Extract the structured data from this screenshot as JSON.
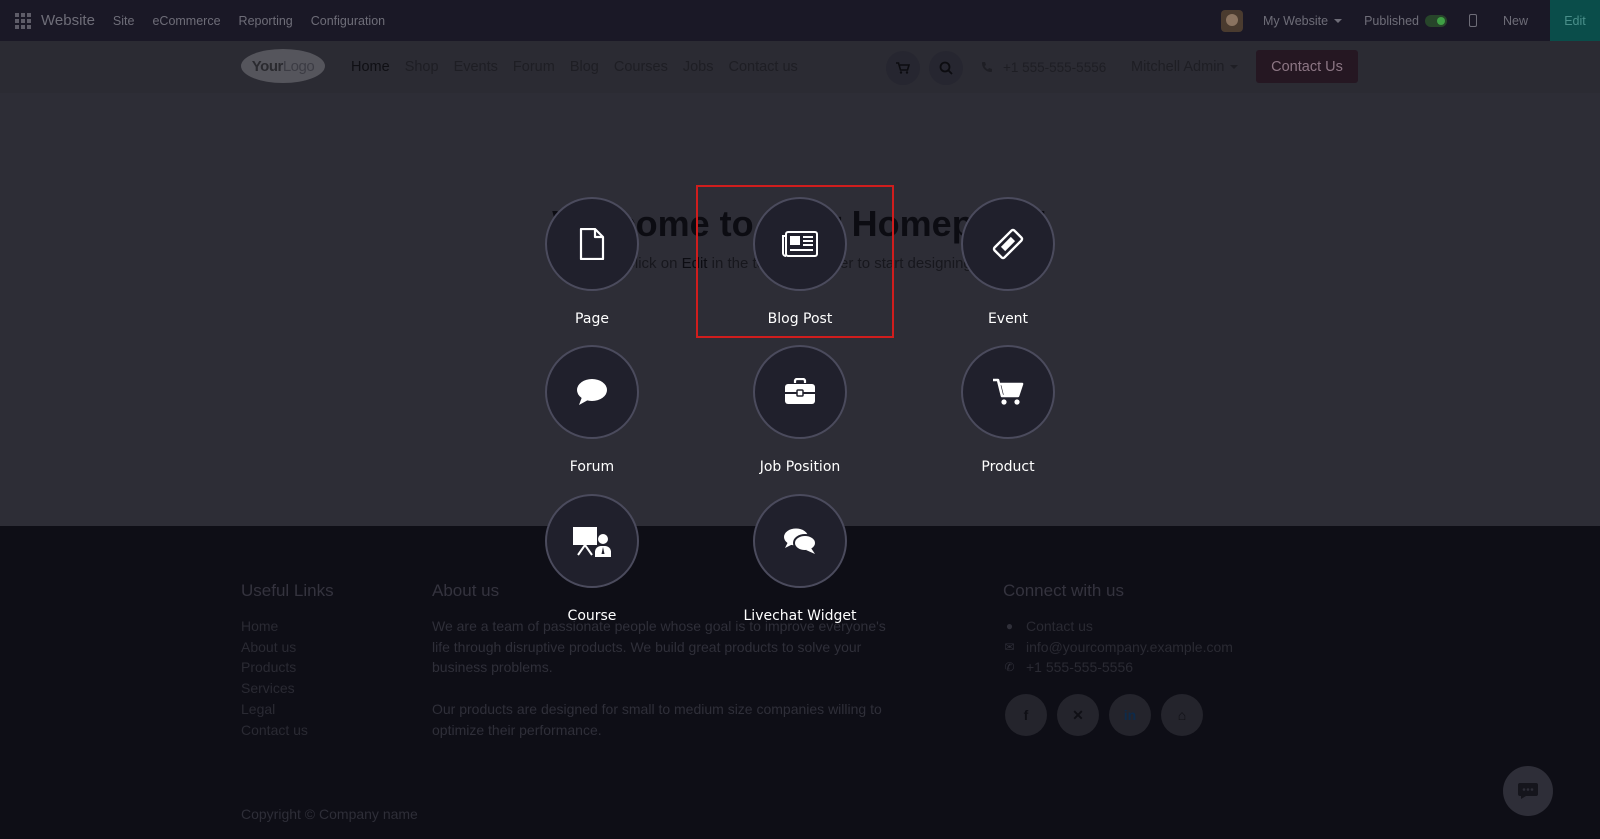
{
  "topbar": {
    "brand": "Website",
    "menu": [
      "Site",
      "eCommerce",
      "Reporting",
      "Configuration"
    ],
    "website_selector": "My Website",
    "published_label": "Published",
    "new_label": "New",
    "edit_label": "Edit"
  },
  "navbar": {
    "logo_bold": "Your",
    "logo_rest": "Logo",
    "links": [
      "Home",
      "Shop",
      "Events",
      "Forum",
      "Blog",
      "Courses",
      "Jobs",
      "Contact us"
    ],
    "phone": "+1 555-555-5556",
    "user": "Mitchell Admin",
    "contact_button": "Contact Us"
  },
  "hero": {
    "title": "Welcome to your Homepage!",
    "subtitle_pre": "Click on ",
    "subtitle_bold": "Edit",
    "subtitle_post": " in the top right corner to start designing."
  },
  "footer": {
    "useful_links_heading": "Useful Links",
    "useful_links": [
      "Home",
      "About us",
      "Products",
      "Services",
      "Legal",
      "Contact us"
    ],
    "about_heading": "About us",
    "about_p1": "We are a team of passionate people whose goal is to improve everyone's life through disruptive products. We build great products to solve your business problems.",
    "about_p2": "Our products are designed for small to medium size companies willing to optimize their performance.",
    "connect_heading": "Connect with us",
    "connect_items": [
      "Contact us",
      "info@yourcompany.example.com",
      "+1 555-555-5556"
    ],
    "copyright": "Copyright © Company name"
  },
  "new_content_options": [
    {
      "label": "Page",
      "icon": "page-icon"
    },
    {
      "label": "Blog Post",
      "icon": "newspaper-icon"
    },
    {
      "label": "Event",
      "icon": "ticket-icon"
    },
    {
      "label": "Forum",
      "icon": "comment-icon"
    },
    {
      "label": "Job Position",
      "icon": "briefcase-icon"
    },
    {
      "label": "Product",
      "icon": "cart-icon"
    },
    {
      "label": "Course",
      "icon": "teacher-icon"
    },
    {
      "label": "Livechat Widget",
      "icon": "comments-icon"
    }
  ],
  "highlighted_option": "Blog Post",
  "colors": {
    "highlight_border": "#d01d1d",
    "option_circle": "#20202c",
    "contact_button": "#251722",
    "edit_button": "#0a4d4a"
  }
}
